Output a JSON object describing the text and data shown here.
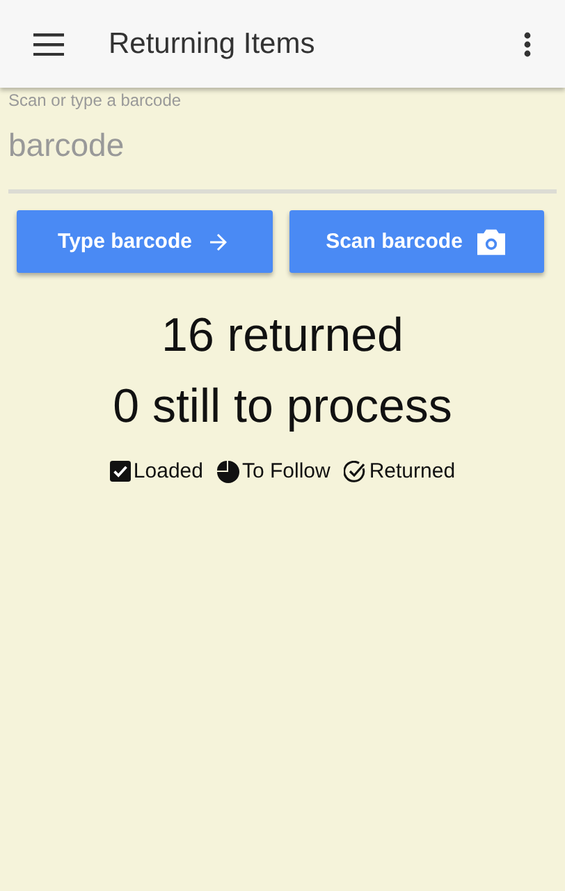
{
  "app_bar": {
    "title": "Returning Items"
  },
  "barcode_field": {
    "label": "Scan or type a barcode",
    "placeholder": "barcode"
  },
  "buttons": [
    {
      "label": "Type barcode",
      "kind": "type"
    },
    {
      "label": "Scan barcode",
      "kind": "scan"
    }
  ],
  "summary": {
    "returned": "16 returned",
    "remaining": "0 still to process"
  },
  "legend": [
    {
      "label": "Loaded",
      "kind": "loaded"
    },
    {
      "label": "To Follow",
      "kind": "to_follow"
    },
    {
      "label": "Returned",
      "kind": "returned"
    }
  ]
}
